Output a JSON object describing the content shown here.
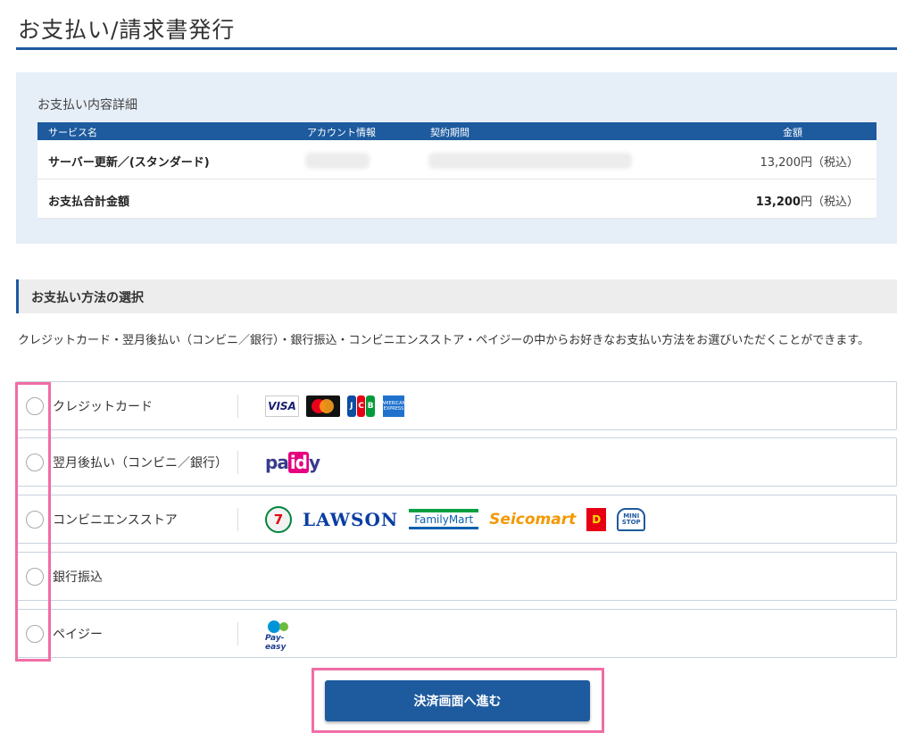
{
  "page": {
    "title": "お支払い/請求書発行"
  },
  "summary": {
    "heading": "お支払い内容詳細",
    "columns": [
      "サービス名",
      "アカウント情報",
      "契約期間",
      "金額"
    ],
    "row": {
      "service": "サーバー更新／(スタンダード)",
      "amount": "13,200円",
      "tax": "（税込）"
    },
    "total": {
      "label": "お支払合計金額",
      "amount": "13,200",
      "unit": "円",
      "tax": "（税込）"
    }
  },
  "method": {
    "section_title": "お支払い方法の選択",
    "description": "クレジットカード・翌月後払い（コンビニ／銀行）・銀行振込・コンビニエンスストア・ペイジーの中からお好きなお支払い方法をお選びいただくことができます。",
    "options": [
      {
        "label": "クレジットカード"
      },
      {
        "label": "翌月後払い（コンビニ／銀行）"
      },
      {
        "label": "コンビニエンスストア"
      },
      {
        "label": "銀行振込"
      },
      {
        "label": "ペイジー"
      }
    ],
    "logos": {
      "visa": "VISA",
      "jcb": "JCB",
      "amex": "AMERICAN EXPRESS",
      "paidy_a": "pa",
      "paidy_b": "id",
      "paidy_c": "y",
      "seven": "7",
      "lawson": "LAWSON",
      "familymart": "FamilyMart",
      "seicomart": "Seicomart",
      "daily": "D",
      "ministop": "MINI STOP",
      "payeasy": "Pay-easy"
    }
  },
  "submit": {
    "label": "決済画面へ進む"
  },
  "colors": {
    "accent": "#1d5a9e",
    "highlight": "#f06da6"
  }
}
